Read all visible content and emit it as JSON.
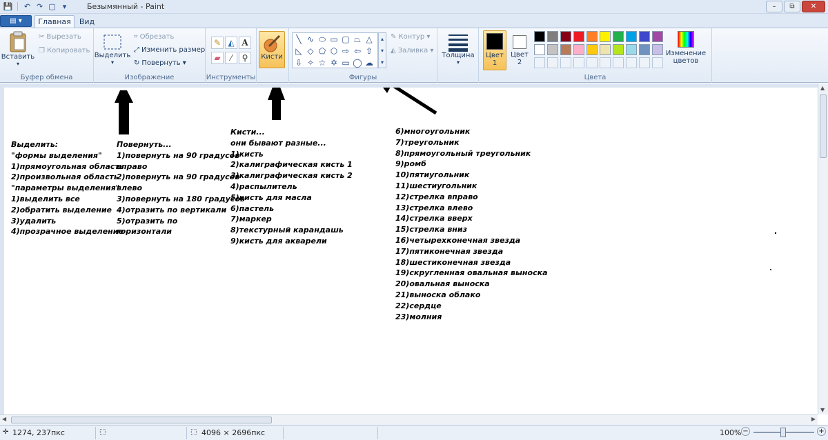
{
  "window": {
    "title": "Безымянный - Paint",
    "minimize": "–",
    "restore": "⧉",
    "close": "✕"
  },
  "qat": {
    "save": "💾",
    "undo": "↶",
    "redo": "↷",
    "new": "▢",
    "more": "▾"
  },
  "tabs": {
    "file": "▤ ▾",
    "home": "Главная",
    "view": "Вид"
  },
  "ribbon": {
    "clipboard": {
      "label": "Буфер обмена",
      "paste": "Вставить",
      "cut": "Вырезать",
      "copy": "Копировать"
    },
    "image": {
      "label": "Изображение",
      "select": "Выделить",
      "crop": "Обрезать",
      "resize": "Изменить размер",
      "rotate": "Повернуть ▾"
    },
    "tools": {
      "label": "Инструменты"
    },
    "brushes": {
      "label": "Кисти"
    },
    "shapes": {
      "label": "Фигуры",
      "outline": "Контур ▾",
      "fill": "Заливка ▾"
    },
    "size": {
      "label": "Толщина"
    },
    "colors": {
      "label": "Цвета",
      "color1": "Цвет 1",
      "color2": "Цвет 2",
      "edit": "Изменение цветов",
      "row1": [
        "#000000",
        "#7f7f7f",
        "#880015",
        "#ed1c24",
        "#ff7f27",
        "#fff200",
        "#22b14c",
        "#00a2e8",
        "#3f48cc",
        "#a349a4"
      ],
      "row2": [
        "#ffffff",
        "#c3c3c3",
        "#b97a57",
        "#ffaec9",
        "#ffc90e",
        "#efe4b0",
        "#b5e61d",
        "#99d9ea",
        "#7092be",
        "#c8bfe7"
      ]
    }
  },
  "canvas": {
    "col1": "Выделить:\n\"формы выделения\"\n1)прямоугольная область\n2)произвольная область\n\"параметры выделения\"\n1)выделить все\n2)обратить выделение\n3)удалить\n4)прозрачное выделение",
    "col2": "Повернуть...\n1)повернуть на 90 градусов\nвправо\n2)повернуть на 90 градусов\nвлево\n3)повернуть на 180 градусов\n4)отразить по вертикали\n5)отразить по\nгоризонтали",
    "col3": "Кисти...\nони бывают разные...\n1)кисть\n2)калиграфическая кисть 1\n3)калиграфическая кисть 2\n4)распылитель\n5)кисть для масла\n6)пастель\n7)маркер\n8)текстурный карандашь\n9)кисть для акварели",
    "col4": "6)многоугольник\n7)треугольник\n8)прямоугольный треугольник\n9)ромб\n10)пятиугольник\n11)шестиугольник\n12)стрелка вправо\n13)стрелка влево\n14)стрелка вверх\n15)стрелка вниз\n16)четырехконечная звезда\n17)пятиконечная звезда\n18)шестиконечная звезда\n19)скругленная овальная выноска\n20)овальная выноска\n21)выноска облако\n22)сердце\n23)молния"
  },
  "status": {
    "cursor": "1274, 237пкс",
    "size": "4096 × 2696пкс",
    "zoom": "100%"
  }
}
